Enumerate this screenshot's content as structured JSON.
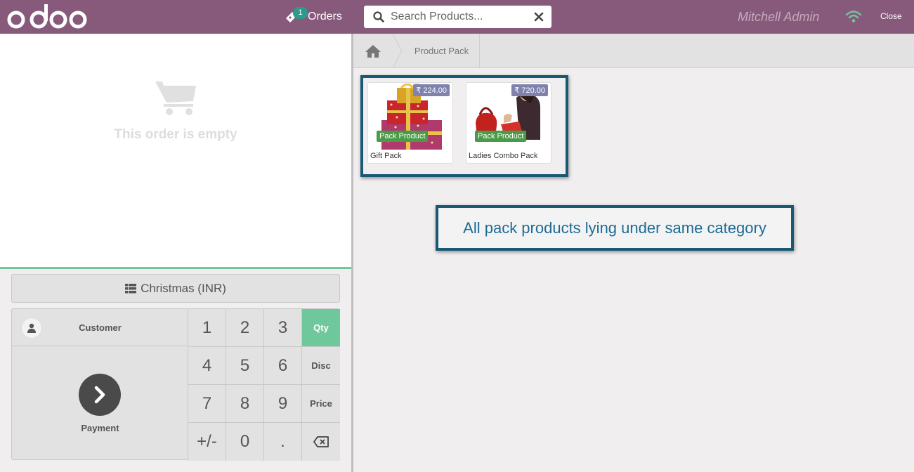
{
  "header": {
    "logo_text": "odoo",
    "orders_label": "Orders",
    "orders_count": "1",
    "search_placeholder": "Search Products...",
    "user_name": "Mitchell Admin",
    "close_label": "Close"
  },
  "order": {
    "empty_text": "This order is empty"
  },
  "pads": {
    "pricelist_label": "Christmas (INR)",
    "customer_label": "Customer",
    "payment_label": "Payment",
    "keys": [
      "1",
      "2",
      "3",
      "4",
      "5",
      "6",
      "7",
      "8",
      "9",
      "+/-",
      "0",
      "."
    ],
    "modes": {
      "qty": "Qty",
      "disc": "Disc",
      "price": "Price"
    },
    "active_mode": "Qty"
  },
  "breadcrumb": {
    "current": "Product Pack"
  },
  "products": [
    {
      "name": "Gift Pack",
      "price": "₹ 224.00",
      "tag": "Pack Product"
    },
    {
      "name": "Ladies Combo Pack",
      "price": "₹ 720.00",
      "tag": "Pack Product"
    }
  ],
  "annotation": {
    "text": "All pack products lying under same category"
  },
  "colors": {
    "header": "#875a7b",
    "accent": "#6ec89b",
    "price_badge": "#7f82ac",
    "pack_tag": "#4b9a47",
    "frame": "#1b5874"
  }
}
